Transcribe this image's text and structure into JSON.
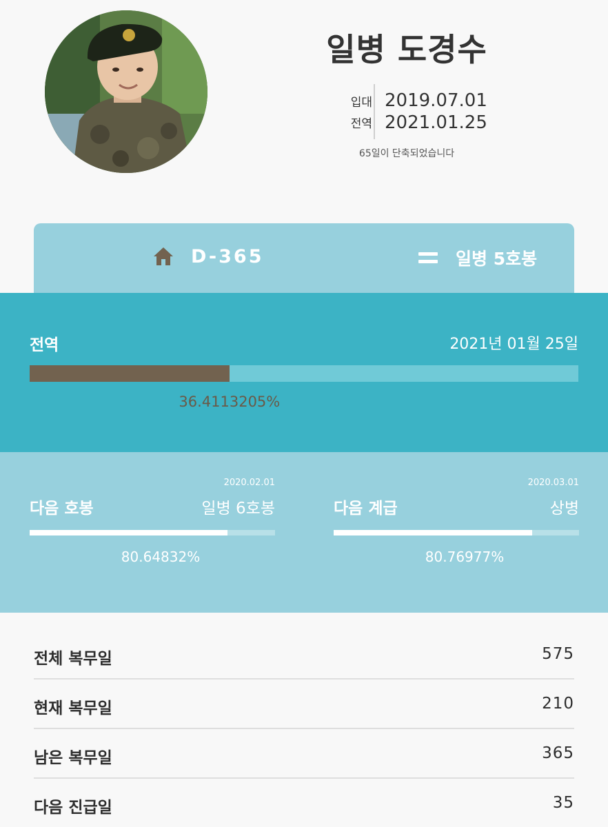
{
  "profile": {
    "name": "일병 도경수",
    "enlist_label": "입대",
    "enlist_date": "2019.07.01",
    "discharge_label": "전역",
    "discharge_date": "2021.01.25",
    "shortened": "65일이 단축되었습니다"
  },
  "summary": {
    "dday": "D-365",
    "rank": "일병 5호봉",
    "home_icon": "home-icon",
    "rank_icon": "equals-icon"
  },
  "discharge": {
    "label": "전역",
    "date": "2021년 01월 25일",
    "percent_text": "36.4113205%",
    "percent": 36.4113205
  },
  "next_pay": {
    "date": "2020.02.01",
    "title": "다음 호봉",
    "value": "일병 6호봉",
    "percent_text": "80.64832%",
    "percent": 80.64832
  },
  "next_rank": {
    "date": "2020.03.01",
    "title": "다음 계급",
    "value": "상병",
    "percent_text": "80.76977%",
    "percent": 80.76977
  },
  "stats": [
    {
      "label": "전체 복무일",
      "value": "575"
    },
    {
      "label": "현재 복무일",
      "value": "210"
    },
    {
      "label": "남은 복무일",
      "value": "365"
    },
    {
      "label": "다음 진급일",
      "value": "35"
    }
  ],
  "colors": {
    "accent": "#3cb3c5",
    "light": "#97d0dd",
    "progress": "#72624f"
  }
}
